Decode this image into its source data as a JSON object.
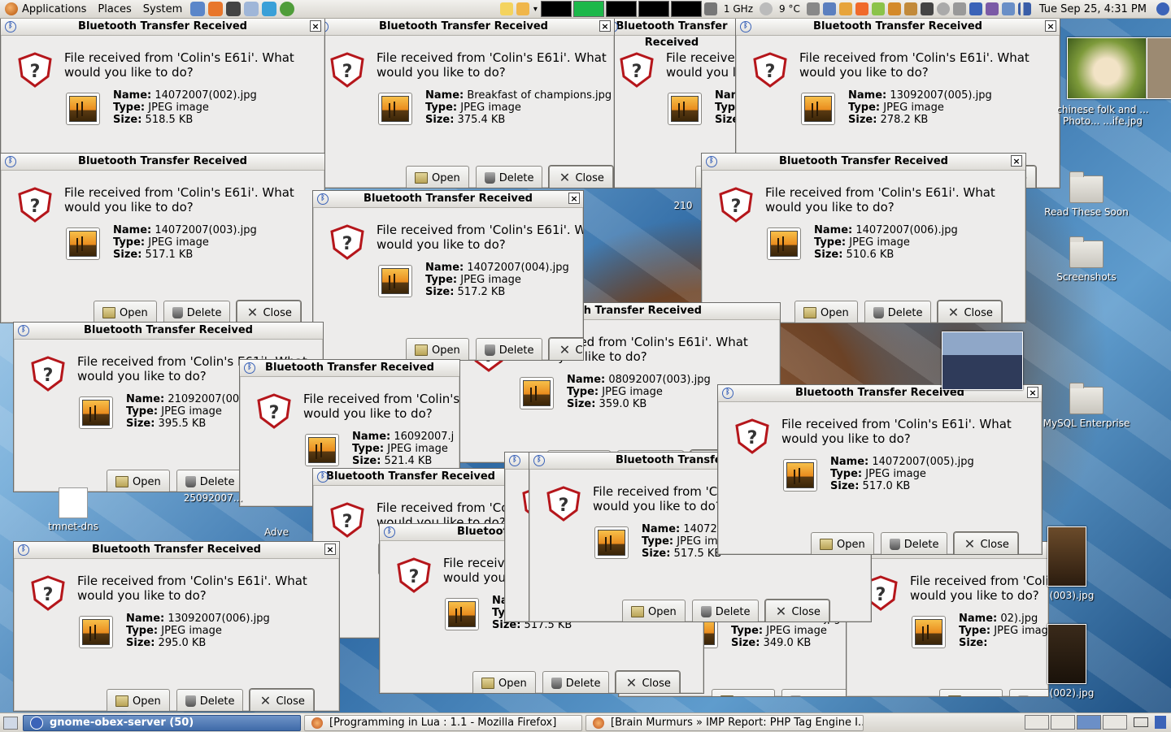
{
  "top_panel": {
    "menus": [
      "Applications",
      "Places",
      "System"
    ],
    "cpu_freq": "1 GHz",
    "temperature": "9 °C",
    "clock": "Tue Sep 25,  4:31 PM"
  },
  "desktop_icons": [
    {
      "label": "chinese folk and ... Photo... ...ife.jpg"
    },
    {
      "label": "Read These Soon"
    },
    {
      "label": "Screenshots"
    },
    {
      "label": "MySQL Enterprise"
    },
    {
      "label": "(003).jpg"
    },
    {
      "label": "(002).jpg"
    },
    {
      "label": "tmnet-dns"
    },
    {
      "label": "25092007..."
    },
    {
      "label": "Adve"
    },
    {
      "label": "210"
    }
  ],
  "dialog_common": {
    "title": "Bluetooth Transfer Received",
    "message_line1": "File received from 'Colin's E61i'. What",
    "message_line2": "would you like to do?",
    "name_label": "Name:",
    "type_label": "Type:",
    "size_label": "Size:",
    "type_value": "JPEG image",
    "open_label": "Open",
    "delete_label": "Delete",
    "close_label": "Close"
  },
  "dialogs": [
    {
      "name": "14072007(002).jpg",
      "size": "518.5 KB"
    },
    {
      "name": "Breakfast of champions.jpg",
      "size": "375.4 KB"
    },
    {
      "name": "13092007(005).jpg",
      "size": "278.2 KB"
    },
    {
      "name": "14072007(003).jpg",
      "size": "517.1 KB"
    },
    {
      "name": "14072007(004).jpg",
      "size": "517.2 KB"
    },
    {
      "name": "14072007(006).jpg",
      "size": "510.6 KB"
    },
    {
      "name": "21092007(005",
      "size": "395.5 KB"
    },
    {
      "name": "08092007(003).jpg",
      "size": "359.0 KB"
    },
    {
      "name": "16092007.j",
      "size": "521.4 KB"
    },
    {
      "name": "14072007(005).jpg",
      "size": "517.0 KB"
    },
    {
      "name": "140720",
      "size": "517.5 KB"
    },
    {
      "name": "13092007(006).jpg",
      "size": "295.0 KB"
    },
    {
      "name": "benetton.jpg",
      "size": "349.0 KB"
    },
    {
      "name": "02).jpg",
      "size": ""
    },
    {
      "name": "092007(001).jpg",
      "size": "5 KB"
    }
  ],
  "taskbar": {
    "tasks": [
      {
        "label": "gnome-obex-server (50)"
      },
      {
        "label": "[Programming in Lua : 1.1 - Mozilla Firefox]"
      },
      {
        "label": "[Brain Murmurs » IMP Report: PHP Tag Engine I..."
      }
    ]
  }
}
